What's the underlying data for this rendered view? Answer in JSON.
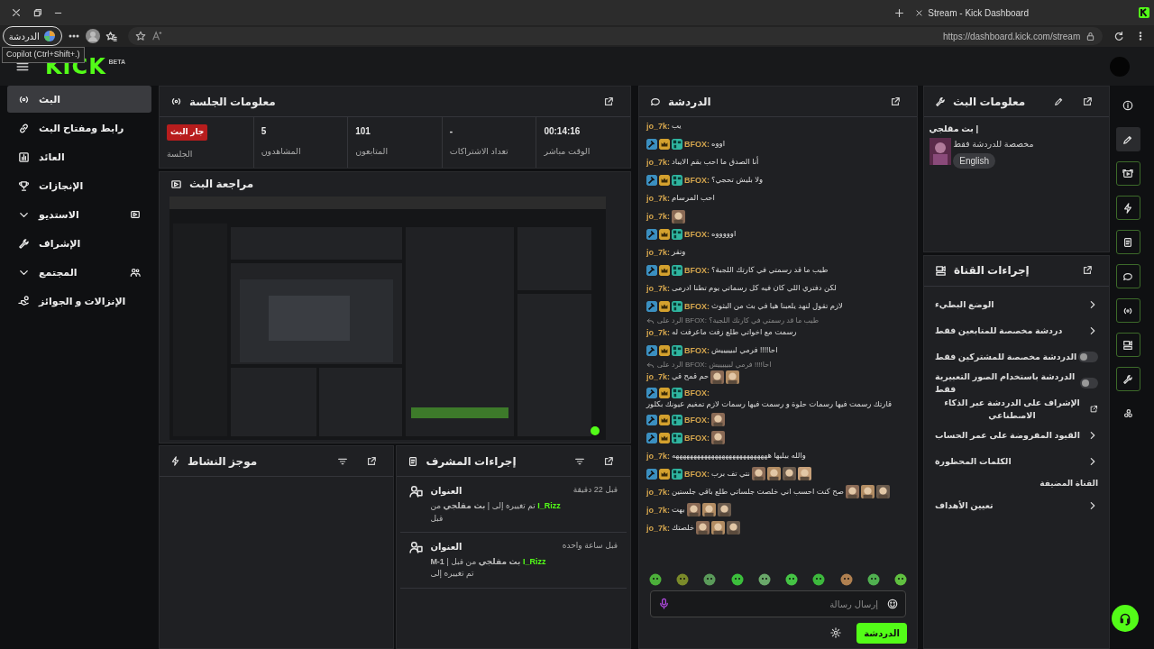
{
  "browser": {
    "tab_title": "Stream - Kick Dashboard",
    "url": "https://dashboard.kick.com/stream",
    "copilot_label": "الدردشة",
    "tooltip": "Copilot (Ctrl+Shift+.)"
  },
  "header": {
    "logo": "KICK",
    "logo_tag": "BETA"
  },
  "sidebar": {
    "items": [
      {
        "label": "البث",
        "kind": "link",
        "selected": true
      },
      {
        "label": "رابط ومفتاح البث",
        "kind": "link",
        "selected": false
      },
      {
        "label": "العائد",
        "kind": "link",
        "selected": false
      },
      {
        "label": "الإنجازات",
        "kind": "link",
        "selected": false
      },
      {
        "label": "الاستديو",
        "kind": "group",
        "selected": false
      },
      {
        "label": "الإشراف",
        "kind": "link",
        "selected": false
      },
      {
        "label": "المجتمع",
        "kind": "group",
        "selected": false
      },
      {
        "label": "الإنزالات و الجوائز",
        "kind": "link",
        "selected": false
      }
    ]
  },
  "session": {
    "title": "معلومات الجلسة",
    "stats": [
      {
        "value": "00:14:16",
        "label": "الوقت مباشر",
        "kind": "number"
      },
      {
        "value": "-",
        "label": "تعداد الاشتراكات",
        "kind": "number"
      },
      {
        "value": "101",
        "label": "المتابعون",
        "kind": "number"
      },
      {
        "value": "5",
        "label": "المشاهدون",
        "kind": "number"
      },
      {
        "value": "جار البث",
        "label": "الجلسة",
        "kind": "badge"
      }
    ]
  },
  "preview": {
    "title": "مراجعة البث",
    "kind": "picture"
  },
  "activity": {
    "title": "موجز النشاط"
  },
  "mod_actions": {
    "title": "إجراءات المشرف",
    "items": [
      {
        "title": "العنوان",
        "actor": "I_Rizz",
        "text": "تم تغييره إلى | **بث مقلجي** من قبل",
        "time": "قبل 22 دقيقة"
      },
      {
        "title": "العنوان",
        "actor": "I_Rizz",
        "text": "**بث مقلجي** من قبل | **M-1** تم تغييره إلى",
        "time": "قبل ساعة واحده"
      }
    ]
  },
  "chat": {
    "title": "الدردشة",
    "messages": [
      {
        "user": "jo_7k:",
        "kind": "plain",
        "text": "يب"
      },
      {
        "user": "BFOX:",
        "kind": "badged",
        "text": "اووه"
      },
      {
        "user": "jo_7k:",
        "kind": "plain",
        "text": "أنا الصدق ما احب بقم الايباد"
      },
      {
        "user": "BFOX:",
        "kind": "badged",
        "text": "ولا بليش تحجي؟"
      },
      {
        "user": "jo_7k:",
        "kind": "plain",
        "text": "احب المرسام"
      },
      {
        "user": "jo_7k:",
        "kind": "plain"
      },
      {
        "user": "BFOX:",
        "kind": "badged",
        "text": "اوووووه"
      },
      {
        "user": "jo_7k:",
        "kind": "plain",
        "text": "وتقر"
      },
      {
        "user": "BFOX:",
        "kind": "badged",
        "text": "طيب ما قد رسمتي في كارتك اللجبة؟"
      },
      {
        "user": "jo_7k:",
        "kind": "plain",
        "text": "لكن دفتري اللي كان فيه كل رسماتي يوم تطنا ادرمى"
      },
      {
        "user": "BFOX:",
        "kind": "badged",
        "text": "لازم تقول لنهد يلعبنا هيا في بث من البثوث"
      },
      {
        "user": "jo_7k:",
        "kind": "plain",
        "reply": "الرد على BFOX: طيب ما قد رسمتي في كارتك اللجبة؟",
        "text": "رسمت مع اخواتي طلع زفت ماعرفت له"
      },
      {
        "user": "BFOX:",
        "kind": "badged",
        "text": "احا!!!! فرمي لبيييييش"
      },
      {
        "user": "jo_7k:",
        "kind": "plain",
        "reply": "الرد على BFOX: احا!!!! فرمي لبيييييش",
        "text": "حم قمح قي"
      },
      {
        "user": "BFOX:",
        "kind": "badged",
        "text": "قارتك رسمت فيها رسمات حلوة و رسمت فيها رسمات لازم تمغيم عيونك بكلور"
      },
      {
        "user": "BFOX:",
        "kind": "badged"
      },
      {
        "user": "BFOX:",
        "kind": "badged"
      },
      {
        "user": "jo_7k:",
        "kind": "plain",
        "text": "والله بيليها هههههههههههههههههههههههههههه"
      },
      {
        "user": "BFOX:",
        "kind": "badged",
        "text": "نتي تف برب"
      },
      {
        "user": "jo_7k:",
        "kind": "plain",
        "text": "صح كنت احسب اني خلصت جلساتي طلع باقي جلستين"
      },
      {
        "user": "jo_7k:",
        "kind": "plain",
        "text": "بهت"
      },
      {
        "user": "jo_7k:",
        "kind": "plain",
        "text": "خلصتك"
      }
    ],
    "placeholder": "إرسال رسالة",
    "send_label": "الدردشة"
  },
  "stream_info": {
    "title": "معلومات البث",
    "stream_title": "بث مقلجي |",
    "category": "مخصصة للدردشة فقط",
    "tag": "English"
  },
  "channel_actions": {
    "title": "إجراءات القناة",
    "items": [
      {
        "label": "الوضع البطيء",
        "kind": "chevron"
      },
      {
        "label": "دردشة مخصصة للمتابعين فقط",
        "kind": "chevron"
      },
      {
        "label": "الدردشة مخصصة للمشتركين فقط",
        "kind": "toggle",
        "on": false
      },
      {
        "label": "الدردشة باستخدام الصور التعبيرية فقط",
        "kind": "toggle",
        "on": false
      },
      {
        "label": "الإشراف على الدردشة عبر الذكاء الاصطناعي",
        "kind": "external"
      },
      {
        "label": "القيود المفروضة على عمر الحساب",
        "kind": "chevron"
      },
      {
        "label": "الكلمات المحظورة",
        "kind": "chevron"
      },
      {
        "label": "القناة المضيفة",
        "kind": "heading"
      },
      {
        "label": "تعيين الأهداف",
        "kind": "chevron"
      }
    ]
  }
}
